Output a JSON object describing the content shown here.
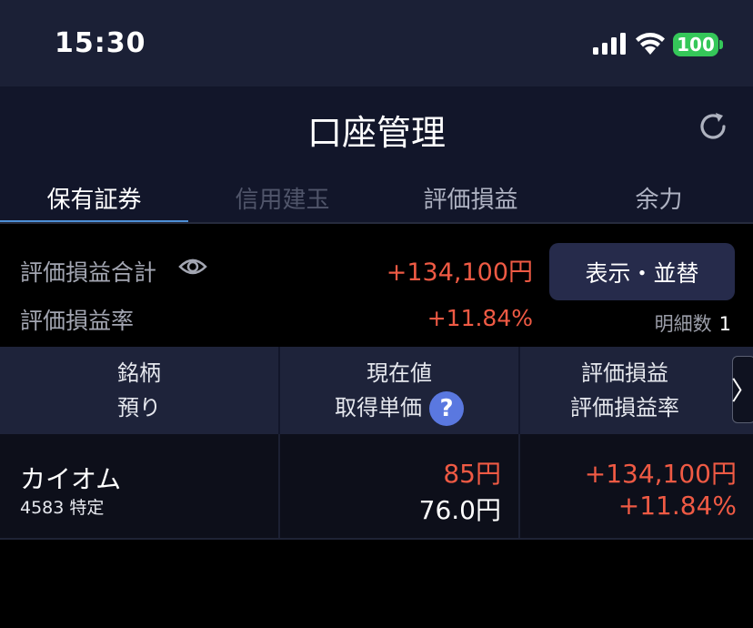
{
  "status_bar": {
    "time": "15:30",
    "battery": "100"
  },
  "header": {
    "title": "口座管理"
  },
  "tabs": [
    {
      "label": "保有証券",
      "state": "active"
    },
    {
      "label": "信用建玉",
      "state": "disabled"
    },
    {
      "label": "評価損益",
      "state": "normal"
    },
    {
      "label": "余力",
      "state": "normal"
    }
  ],
  "summary": {
    "total_label": "評価損益合計",
    "total_value": "+134,100円",
    "rate_label": "評価損益率",
    "rate_value": "+11.84%",
    "display_button": "表示・並替",
    "detail_count_label": "明細数",
    "detail_count": "1"
  },
  "table": {
    "headers": {
      "col1_line1": "銘柄",
      "col1_line2": "預り",
      "col2_line1": "現在値",
      "col2_line2": "取得単価",
      "col3_line1": "評価損益",
      "col3_line2": "評価損益率"
    },
    "scroll_glyph": "〉",
    "help_glyph": "?",
    "rows": [
      {
        "name": "カイオム",
        "code_account": "4583 特定",
        "current_price": "85円",
        "acquisition_price": "76.0円",
        "pl_amount": "+134,100円",
        "pl_rate": "+11.84%"
      }
    ]
  },
  "colors": {
    "positive": "#ef5a44",
    "tab_indicator": "#4d8fd6",
    "battery": "#35c759",
    "help": "#5a78e0"
  }
}
